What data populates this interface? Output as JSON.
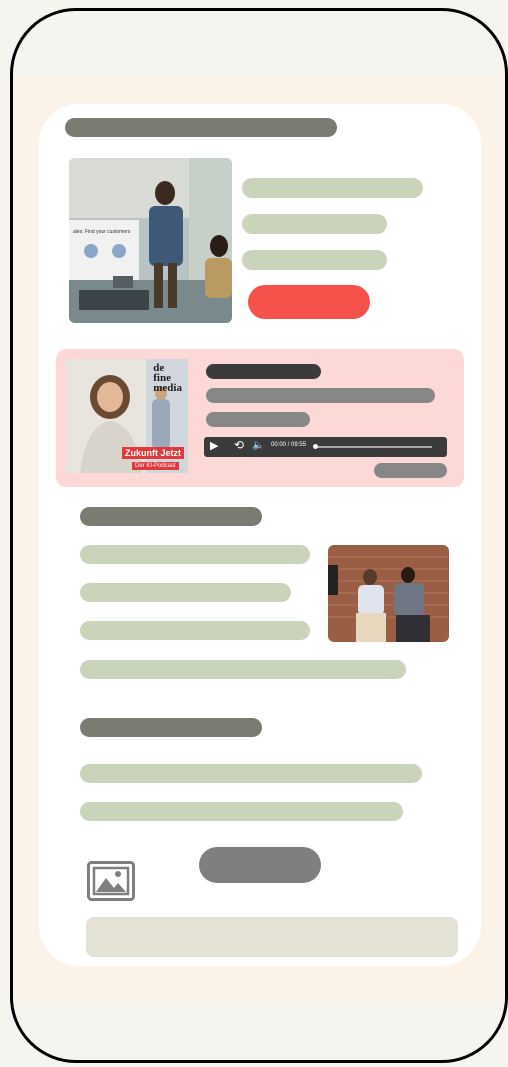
{
  "podcast": {
    "brand_line1": "de",
    "brand_line2": "fine",
    "brand_line3": "media",
    "cover_title": "Zukunft Jetzt",
    "cover_subtitle": "Der KI-Podcast",
    "time": "00:00 / 09:55"
  },
  "icons": {
    "play": "play-icon",
    "rewind": "rewind-15-icon",
    "volume": "volume-icon",
    "image": "image-placeholder-icon"
  },
  "colors": {
    "accent_red": "#f5524c",
    "podcast_bg": "#fcd9d6",
    "skeleton_green": "#c9d4bb",
    "skeleton_dark": "#7a7c72"
  }
}
